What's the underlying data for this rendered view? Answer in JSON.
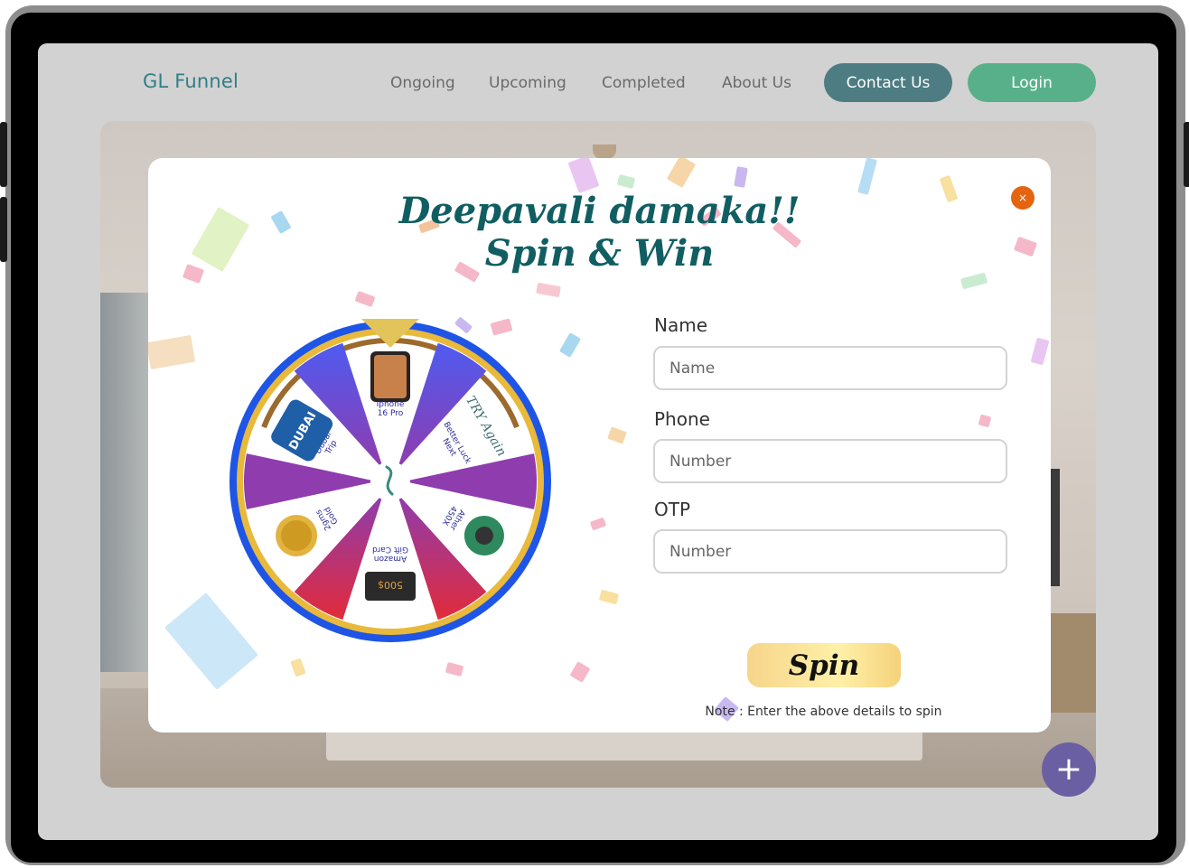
{
  "nav": {
    "brand": "GL Funnel",
    "links": [
      "Ongoing",
      "Upcoming",
      "Completed",
      "About Us"
    ],
    "contact_label": "Contact Us",
    "login_label": "Login"
  },
  "modal": {
    "title_line1": "Deepavali damaka!!",
    "title_line2": "Spin & Win",
    "close_icon": "×"
  },
  "wheel": {
    "prizes": [
      {
        "label_line1": "Iphone",
        "label_line2": "16 Pro",
        "icon": "phone-icon"
      },
      {
        "label_line1": "Better Luck",
        "label_line2": "Next",
        "icon": "try-again-icon"
      },
      {
        "label_line1": "Ather",
        "label_line2": "450X",
        "icon": "scooter-icon"
      },
      {
        "label_line1": "Amazon",
        "label_line2": "Gift Card",
        "icon": "gift-card-icon"
      },
      {
        "label_line1": "2gms",
        "label_line2": "Gold",
        "icon": "gold-coin-icon"
      },
      {
        "label_line1": "Dubai",
        "label_line2": "Trip",
        "icon": "dubai-trip-icon"
      }
    ],
    "gift_card_amount": "500$",
    "dubai_text": "DUBAI",
    "try_again_text": "TRY Again",
    "colors": {
      "blue": "#4f5bf1",
      "purple": "#8e3cae",
      "red": "#e22b3a",
      "rim": "#1e55e6",
      "gold": "#e8b93b"
    }
  },
  "form": {
    "name_label": "Name",
    "name_placeholder": "Name",
    "phone_label": "Phone",
    "phone_placeholder": "Number",
    "otp_label": "OTP",
    "otp_placeholder": "Number",
    "spin_label": "Spin",
    "note": "Note : Enter the above details to spin"
  },
  "fab": {
    "icon": "plus-icon",
    "symbol": "+"
  }
}
